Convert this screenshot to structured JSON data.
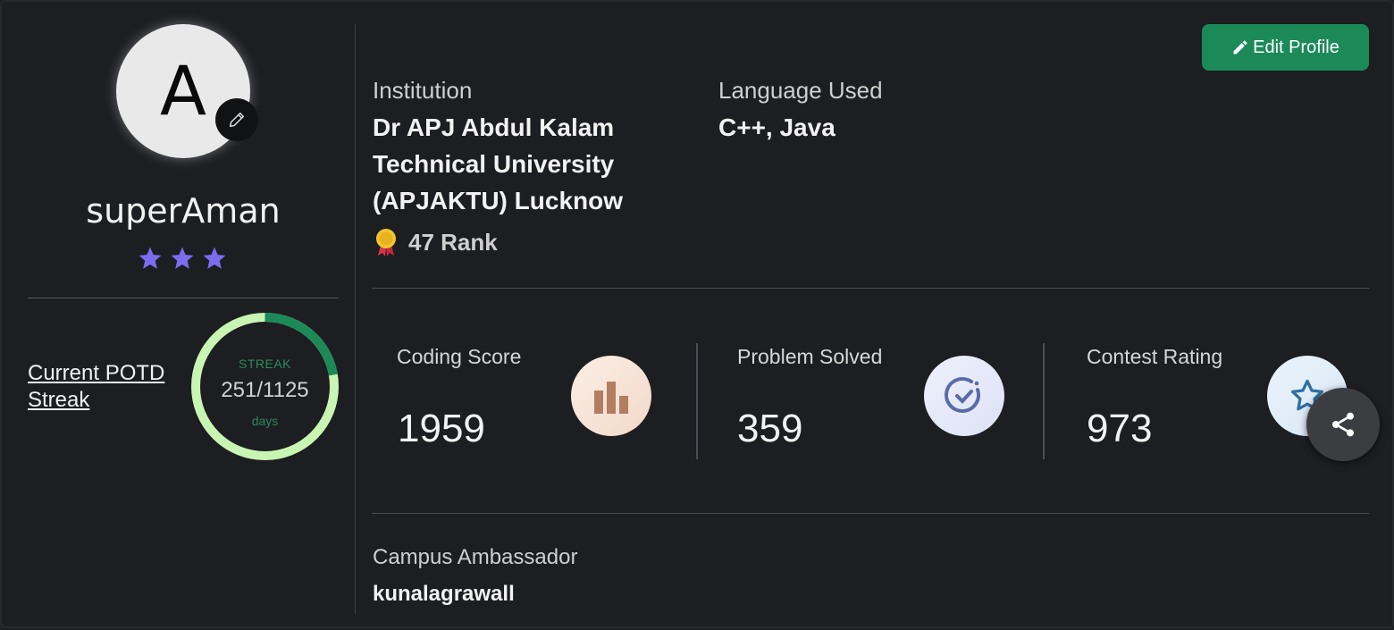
{
  "profile": {
    "avatar_letter": "A",
    "username": "superAman",
    "star_count": 3,
    "star_color": "#7b6cf0"
  },
  "potd": {
    "label": "Current POTD Streak",
    "streak_label": "STREAK",
    "streak_value": "251/1125",
    "streak_unit": "days",
    "streak_fraction": 0.223
  },
  "header": {
    "edit_profile_label": "Edit Profile",
    "accent_color": "#1c8a58"
  },
  "institution": {
    "label": "Institution",
    "value": "Dr APJ Abdul Kalam Technical University (APJAKTU) Lucknow",
    "rank": "47 Rank"
  },
  "language": {
    "label": "Language Used",
    "value": "C++, Java"
  },
  "stats": [
    {
      "label": "Coding Score",
      "value": "1959",
      "icon": "bar-chart-icon"
    },
    {
      "label": "Problem Solved",
      "value": "359",
      "icon": "check-circle-icon"
    },
    {
      "label": "Contest Rating",
      "value": "973",
      "icon": "star-icon"
    }
  ],
  "campus": {
    "label": "Campus Ambassador",
    "value": "kunalagrawall"
  }
}
